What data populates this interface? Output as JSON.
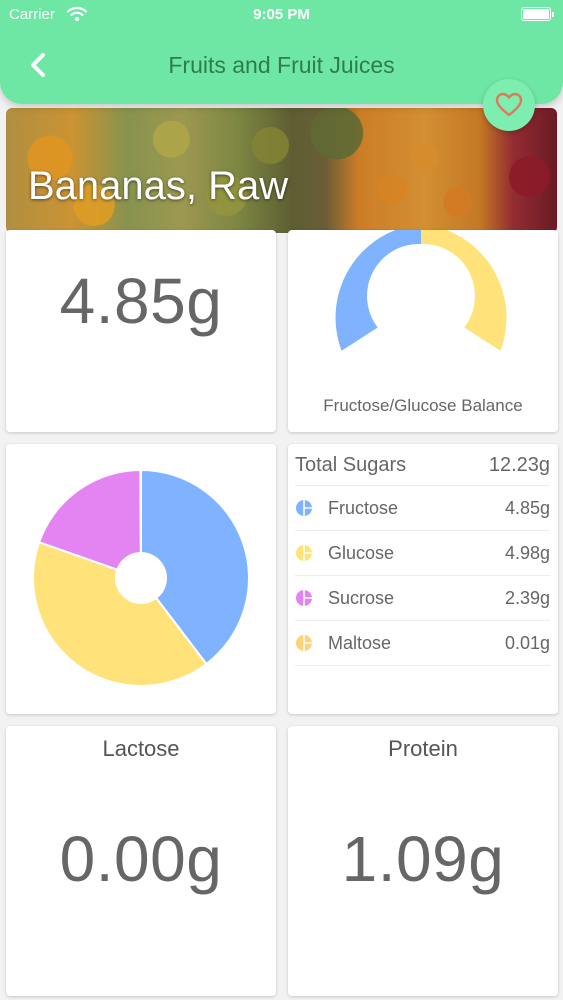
{
  "status_bar": {
    "carrier": "Carrier",
    "time": "9:05 PM"
  },
  "header": {
    "title": "Fruits and Fruit Juices"
  },
  "hero": {
    "title": "Bananas, Raw"
  },
  "fructose_card": {
    "value": "4.85g"
  },
  "balance_card": {
    "caption": "Fructose/Glucose Balance"
  },
  "sugars": {
    "total_label": "Total Sugars",
    "total_value": "12.23g",
    "items": [
      {
        "label": "Fructose",
        "value": "4.85g",
        "color": "#7fb3ff"
      },
      {
        "label": "Glucose",
        "value": "4.98g",
        "color": "#ffe27a"
      },
      {
        "label": "Sucrose",
        "value": "2.39g",
        "color": "#e483f2"
      },
      {
        "label": "Maltose",
        "value": "0.01g",
        "color": "#ffd27a"
      }
    ]
  },
  "lactose_card": {
    "title": "Lactose",
    "value": "0.00g"
  },
  "protein_card": {
    "title": "Protein",
    "value": "1.09g"
  },
  "colors": {
    "header_bg": "#6ee7a4",
    "title_text": "#2e7d4f",
    "favorite_bg": "#7dedb0",
    "heart": "#e0795a",
    "fructose": "#7fb3ff",
    "glucose": "#ffe27a",
    "sucrose": "#e483f2"
  },
  "icons": {
    "back": "chevron-left-icon",
    "favorite": "heart-outline-icon",
    "wifi": "wifi-icon",
    "battery": "battery-icon"
  },
  "chart_data": [
    {
      "type": "pie",
      "categories": [
        "Fructose",
        "Glucose",
        "Sucrose",
        "Maltose"
      ],
      "values": [
        4.85,
        4.98,
        2.39,
        0.01
      ],
      "colors": [
        "#7fb3ff",
        "#ffe27a",
        "#e483f2",
        "#ffd27a"
      ],
      "donut_hole": true
    },
    {
      "type": "pie",
      "categories": [
        "Fructose",
        "Glucose"
      ],
      "values": [
        4.85,
        4.98
      ],
      "colors": [
        "#7fb3ff",
        "#ffe27a"
      ],
      "half_donut": true
    }
  ]
}
